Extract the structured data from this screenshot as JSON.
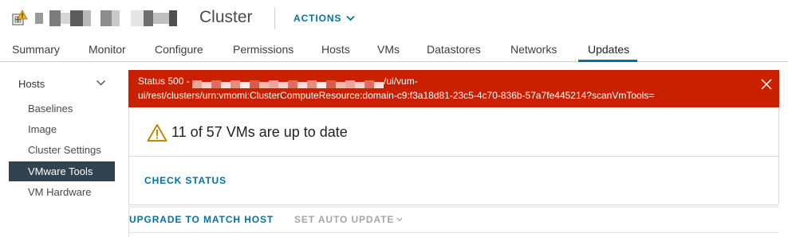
{
  "header": {
    "title": "Cluster",
    "actions_label": "ACTIONS",
    "redaction_colors": [
      "#9a9a9a",
      "#ffffff",
      "#7c7c7c",
      "#d6d6d6",
      "#5c5c5c",
      "#b8b8b8",
      "#ffffff",
      "#8d8d8d",
      "#c9c9c9",
      "#ffffff",
      "#e5e5e5",
      "#6f6f6f",
      "#bfbfbf",
      "#4f4f4f"
    ]
  },
  "tabs": [
    {
      "label": "Summary",
      "active": false
    },
    {
      "label": "Monitor",
      "active": false
    },
    {
      "label": "Configure",
      "active": false
    },
    {
      "label": "Permissions",
      "active": false
    },
    {
      "label": "Hosts",
      "active": false
    },
    {
      "label": "VMs",
      "active": false
    },
    {
      "label": "Datastores",
      "active": false
    },
    {
      "label": "Networks",
      "active": false
    },
    {
      "label": "Updates",
      "active": true
    }
  ],
  "sidebar": {
    "section_label": "Hosts",
    "items": [
      {
        "label": "Baselines",
        "active": false
      },
      {
        "label": "Image",
        "active": false
      },
      {
        "label": "Cluster Settings",
        "active": false
      },
      {
        "label": "VMware Tools",
        "active": true
      },
      {
        "label": "VM Hardware",
        "active": false
      }
    ]
  },
  "alert": {
    "line1_prefix": "Status 500 - ",
    "line1_suffix": "/ui/vum-",
    "line2": "ui/rest/clusters/urn:vmomi:ClusterComputeResource:domain-c9:f3a18d81-23c5-4c70-836b-57a7fe445214?scanVmTools=",
    "color": "#c92100"
  },
  "status": {
    "message": "11 of 57 VMs are up to date",
    "icon": "warning-icon"
  },
  "buttons": {
    "check_status": "CHECK STATUS",
    "upgrade": "UPGRADE TO MATCH HOST",
    "auto_update": "SET AUTO UPDATE"
  },
  "colors": {
    "accent": "#0072a3",
    "nav_active_bg": "#314351",
    "warning": "#c28a00"
  }
}
